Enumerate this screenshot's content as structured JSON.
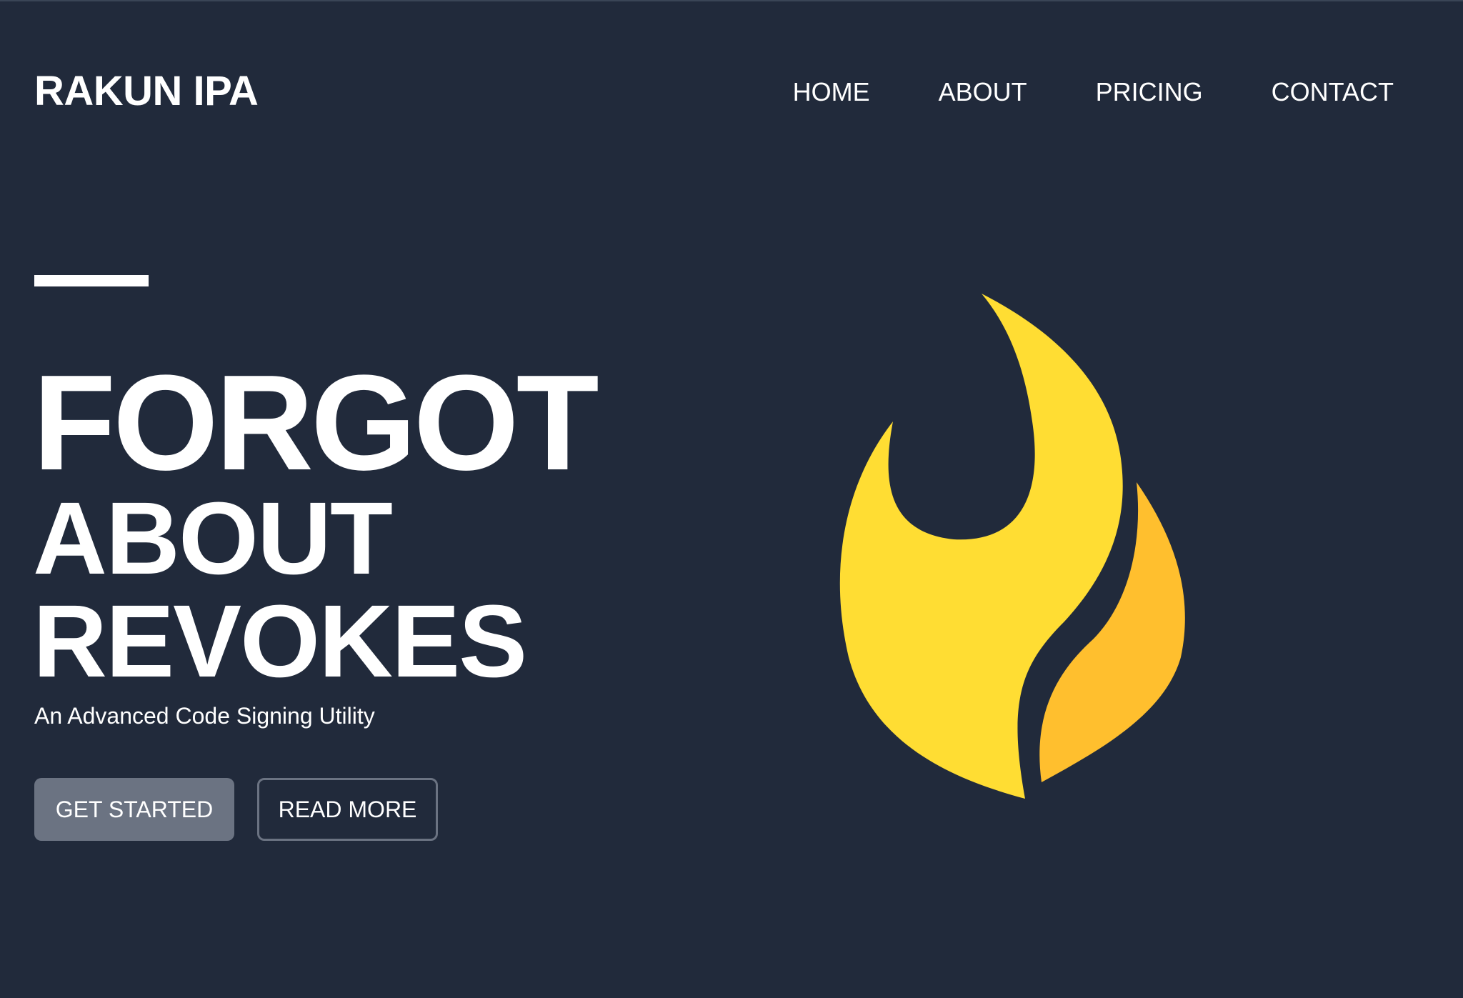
{
  "header": {
    "brand": "RAKUN IPA",
    "nav": [
      {
        "label": "HOME"
      },
      {
        "label": "ABOUT"
      },
      {
        "label": "PRICING"
      },
      {
        "label": "CONTACT"
      }
    ]
  },
  "hero": {
    "headline": [
      "FORGOT",
      "ABOUT",
      "REVOKES"
    ],
    "tagline": "An Advanced Code Signing Utility",
    "primary_button": "GET STARTED",
    "secondary_button": "READ MORE",
    "logo_icon": "flame-icon"
  },
  "colors": {
    "background": "#212a3b",
    "text": "#ffffff",
    "button_fill": "#6b7382",
    "flame_main": "#ffdd33",
    "flame_secondary": "#ffbf2e"
  }
}
